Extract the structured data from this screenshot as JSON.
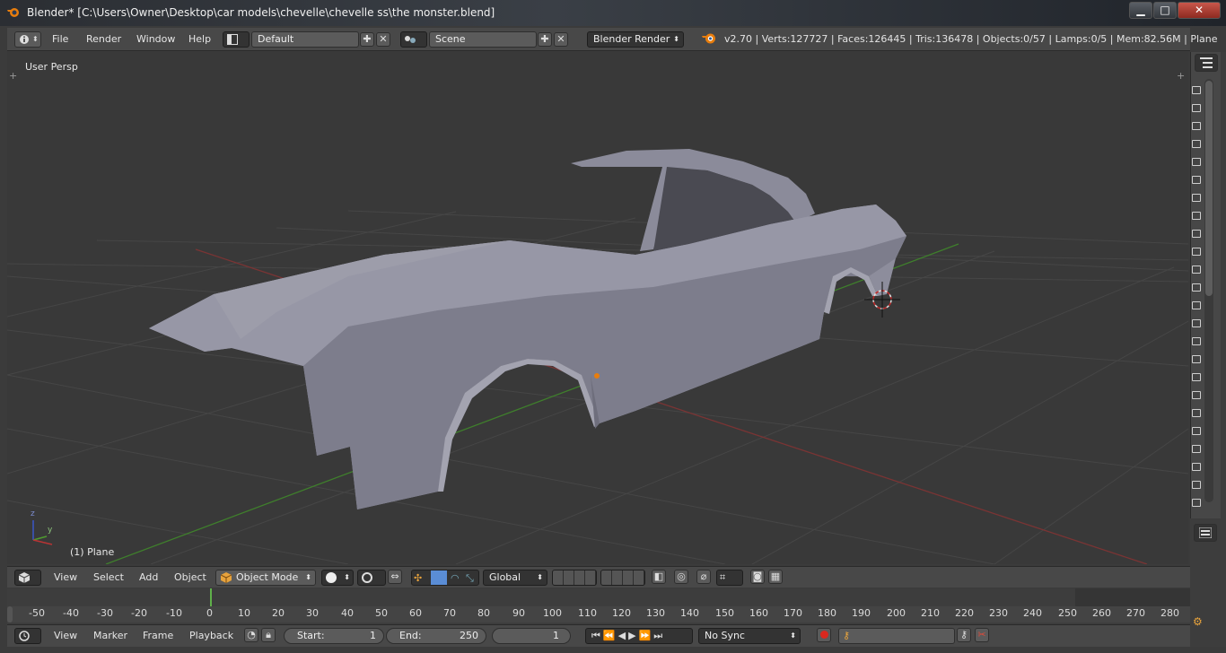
{
  "window": {
    "title": "Blender* [C:\\Users\\Owner\\Desktop\\car models\\chevelle\\chevelle ss\\the monster.blend]",
    "minimize": "▁",
    "maximize": "□",
    "close": "✕"
  },
  "info_header": {
    "menus": [
      "File",
      "Render",
      "Window",
      "Help"
    ],
    "screen_layout": "Default",
    "scene": "Scene",
    "render_engine": "Blender Render",
    "stats": "v2.70 | Verts:127727 | Faces:126445 | Tris:136478 | Objects:0/57 | Lamps:0/5 | Mem:82.56M | Plane"
  },
  "viewport": {
    "view_label": "User Persp",
    "object_label": "(1) Plane",
    "axis_y": "y",
    "axis_z": "z",
    "plus_left": "+",
    "plus_right": "+"
  },
  "viewport_header": {
    "menus": [
      "View",
      "Select",
      "Add",
      "Object"
    ],
    "mode": "Object Mode",
    "orientation": "Global"
  },
  "timeline": {
    "ticks": [
      "-50",
      "-40",
      "-30",
      "-20",
      "-10",
      "0",
      "10",
      "20",
      "30",
      "40",
      "50",
      "60",
      "70",
      "80",
      "90",
      "100",
      "110",
      "120",
      "130",
      "140",
      "150",
      "160",
      "170",
      "180",
      "190",
      "200",
      "210",
      "220",
      "230",
      "240",
      "250",
      "260",
      "270",
      "280"
    ],
    "current_frame": "1",
    "menus": [
      "View",
      "Marker",
      "Frame",
      "Playback"
    ],
    "start_label": "Start:",
    "start_value": "1",
    "end_label": "End:",
    "end_value": "250",
    "sync": "No Sync"
  },
  "colors": {
    "accent_orange": "#e87d0d",
    "x_axis": "#8a3a3a",
    "y_axis": "#4f8c2f",
    "car_body": "#8f8f9e"
  }
}
